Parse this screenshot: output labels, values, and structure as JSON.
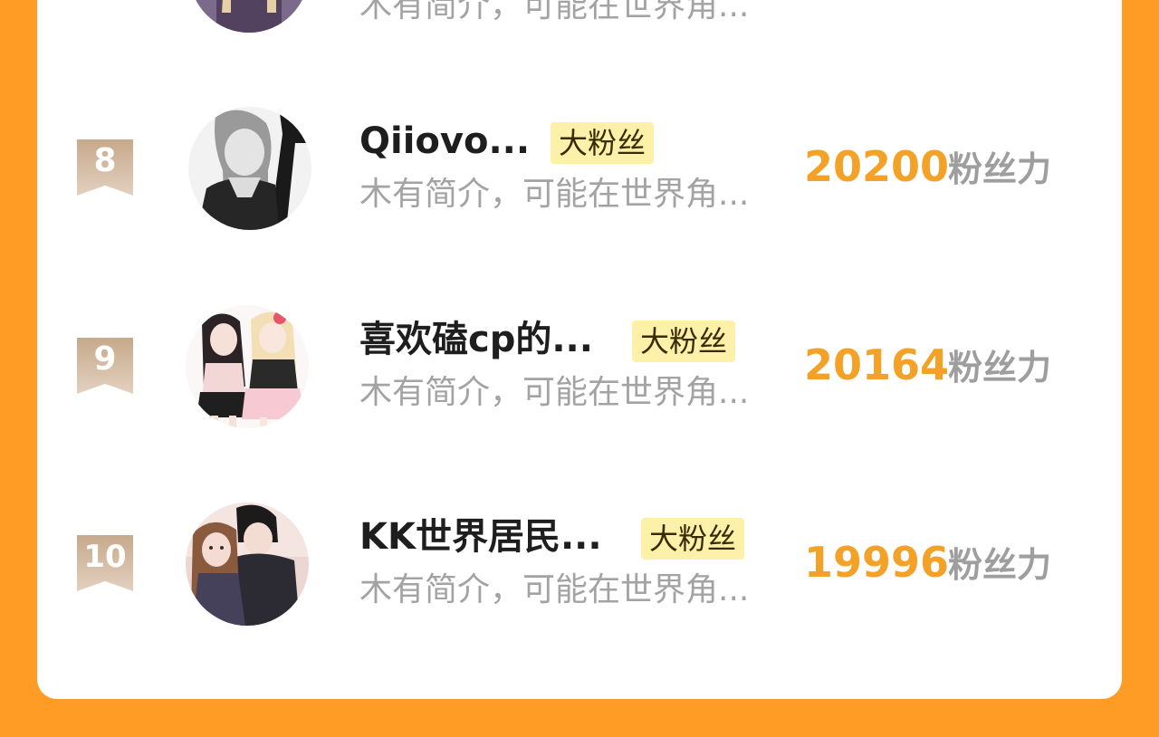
{
  "colors": {
    "background": "#ff9c26",
    "card": "#ffffff",
    "score": "#f3a127",
    "tag_bg": "#fdf0a8"
  },
  "previous_row": {
    "intro": "木有简介，可能在世界角..."
  },
  "rows": [
    {
      "rank": "8",
      "name": "Qiiovo...",
      "tag": "大粉丝",
      "intro": "木有简介，可能在世界角...",
      "score": "20200",
      "unit": "粉丝力",
      "avatar_icon": "avatar-girl-grayscale"
    },
    {
      "rank": "9",
      "name": "喜欢磕cp的...",
      "tag": "大粉丝",
      "intro": "木有简介，可能在世界角...",
      "score": "20164",
      "unit": "粉丝力",
      "avatar_icon": "avatar-two-girls"
    },
    {
      "rank": "10",
      "name": "KK世界居民...",
      "tag": "大粉丝",
      "intro": "木有简介，可能在世界角...",
      "score": "19996",
      "unit": "粉丝力",
      "avatar_icon": "avatar-couple"
    }
  ]
}
